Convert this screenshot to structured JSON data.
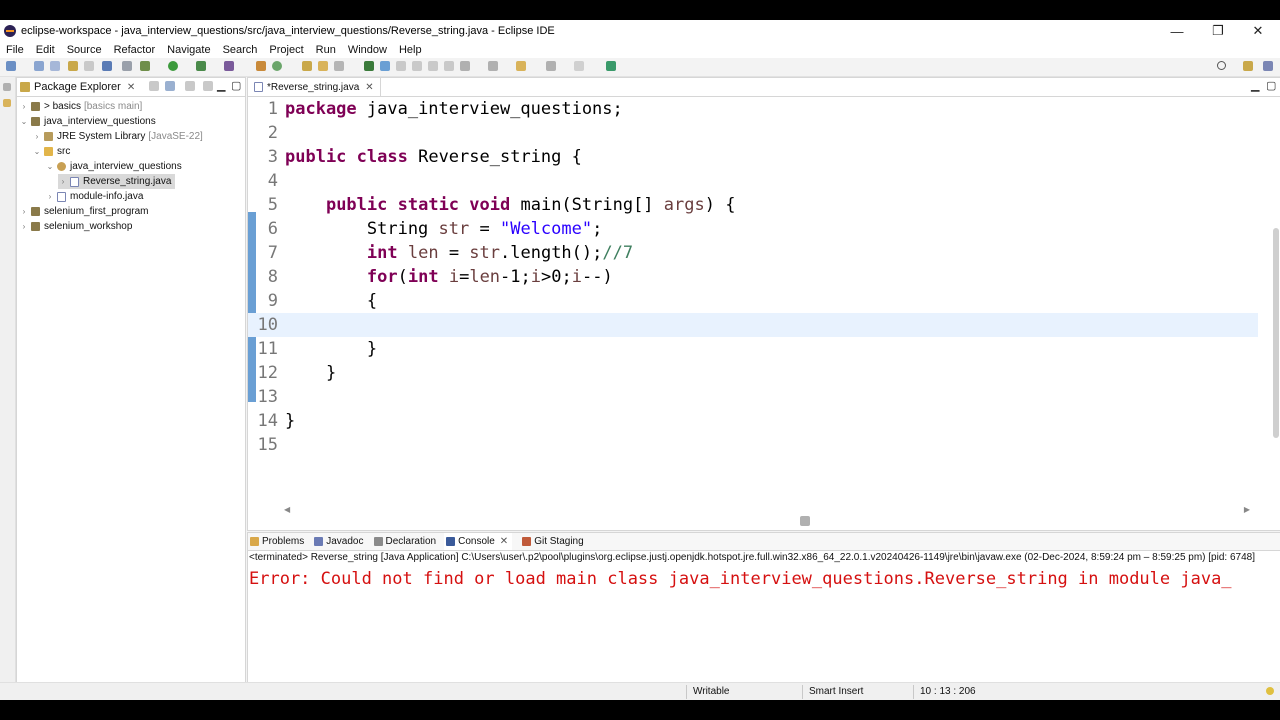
{
  "window": {
    "title": "eclipse-workspace - java_interview_questions/src/java_interview_questions/Reverse_string.java - Eclipse IDE",
    "controls": [
      "—",
      "❐",
      "✕"
    ]
  },
  "menu": [
    "File",
    "Edit",
    "Source",
    "Refactor",
    "Navigate",
    "Search",
    "Project",
    "Run",
    "Window",
    "Help"
  ],
  "package_explorer": {
    "tab_label": "Package Explorer",
    "tree": [
      {
        "label": "> basics",
        "decoration": "[basics main]",
        "expanded": false
      },
      {
        "label": "java_interview_questions",
        "decoration": "",
        "expanded": true
      },
      {
        "label": "JRE System Library",
        "decoration": "[JavaSE-22]",
        "expanded": false
      },
      {
        "label": "src",
        "decoration": "",
        "expanded": true
      },
      {
        "label": "java_interview_questions",
        "decoration": "",
        "expanded": true
      },
      {
        "label": "Reverse_string.java",
        "decoration": "",
        "expanded": false
      },
      {
        "label": "module-info.java",
        "decoration": "",
        "expanded": false
      },
      {
        "label": "selenium_first_program",
        "decoration": "",
        "expanded": false
      },
      {
        "label": "selenium_workshop",
        "decoration": "",
        "expanded": false
      }
    ]
  },
  "editor": {
    "tab_label": "*Reverse_string.java",
    "current_line": 10,
    "lines": [
      {
        "n": "1",
        "code": [
          {
            "t": "package",
            "c": "kw"
          },
          {
            "t": " java_interview_questions;",
            "c": ""
          }
        ]
      },
      {
        "n": "2",
        "code": []
      },
      {
        "n": "3",
        "code": [
          {
            "t": "public",
            "c": "kw"
          },
          {
            "t": " ",
            "c": ""
          },
          {
            "t": "class",
            "c": "kw"
          },
          {
            "t": " Reverse_string {",
            "c": ""
          }
        ]
      },
      {
        "n": "4",
        "code": []
      },
      {
        "n": "5",
        "code": [
          {
            "t": "    ",
            "c": ""
          },
          {
            "t": "public",
            "c": "kw"
          },
          {
            "t": " ",
            "c": ""
          },
          {
            "t": "static",
            "c": "kw"
          },
          {
            "t": " ",
            "c": ""
          },
          {
            "t": "void",
            "c": "kw"
          },
          {
            "t": " main(String[] ",
            "c": ""
          },
          {
            "t": "args",
            "c": "var"
          },
          {
            "t": ") {",
            "c": ""
          }
        ]
      },
      {
        "n": "6",
        "code": [
          {
            "t": "        String ",
            "c": ""
          },
          {
            "t": "str",
            "c": "var"
          },
          {
            "t": " = ",
            "c": ""
          },
          {
            "t": "\"Welcome\"",
            "c": "str"
          },
          {
            "t": ";",
            "c": ""
          }
        ]
      },
      {
        "n": "7",
        "code": [
          {
            "t": "        ",
            "c": ""
          },
          {
            "t": "int",
            "c": "kw"
          },
          {
            "t": " ",
            "c": ""
          },
          {
            "t": "len",
            "c": "var"
          },
          {
            "t": " = ",
            "c": ""
          },
          {
            "t": "str",
            "c": "var"
          },
          {
            "t": ".length();",
            "c": ""
          },
          {
            "t": "//7",
            "c": "cm"
          }
        ]
      },
      {
        "n": "8",
        "code": [
          {
            "t": "        ",
            "c": ""
          },
          {
            "t": "for",
            "c": "kw"
          },
          {
            "t": "(",
            "c": ""
          },
          {
            "t": "int",
            "c": "kw"
          },
          {
            "t": " ",
            "c": ""
          },
          {
            "t": "i",
            "c": "var"
          },
          {
            "t": "=",
            "c": ""
          },
          {
            "t": "len",
            "c": "var"
          },
          {
            "t": "-1;",
            "c": ""
          },
          {
            "t": "i",
            "c": "var"
          },
          {
            "t": ">0;",
            "c": ""
          },
          {
            "t": "i",
            "c": "var"
          },
          {
            "t": "--)",
            "c": ""
          }
        ]
      },
      {
        "n": "9",
        "code": [
          {
            "t": "        {",
            "c": ""
          }
        ]
      },
      {
        "n": "10",
        "code": []
      },
      {
        "n": "11",
        "code": [
          {
            "t": "        }",
            "c": ""
          }
        ]
      },
      {
        "n": "12",
        "code": [
          {
            "t": "    }",
            "c": ""
          }
        ]
      },
      {
        "n": "13",
        "code": []
      },
      {
        "n": "14",
        "code": [
          {
            "t": "}",
            "c": ""
          }
        ]
      },
      {
        "n": "15",
        "code": []
      }
    ]
  },
  "console": {
    "tabs": [
      "Problems",
      "Javadoc",
      "Declaration",
      "Console",
      "Git Staging"
    ],
    "active_tab": "Console",
    "path": "<terminated> Reverse_string [Java Application] C:\\Users\\user\\.p2\\pool\\plugins\\org.eclipse.justj.openjdk.hotspot.jre.full.win32.x86_64_22.0.1.v20240426-1149\\jre\\bin\\javaw.exe  (02-Dec-2024, 8:59:24 pm – 8:59:25 pm) [pid: 6748]",
    "error": "Error: Could not find or load main class java_interview_questions.Reverse_string in module java_"
  },
  "status": {
    "writable": "Writable",
    "insert_mode": "Smart Insert",
    "position": "10 : 13 : 206"
  },
  "colors": {
    "keyword": "#7f0055",
    "string": "#2a00ff",
    "comment": "#3f7f5f",
    "error": "#d51010",
    "current_line": "#e8f2fe"
  }
}
